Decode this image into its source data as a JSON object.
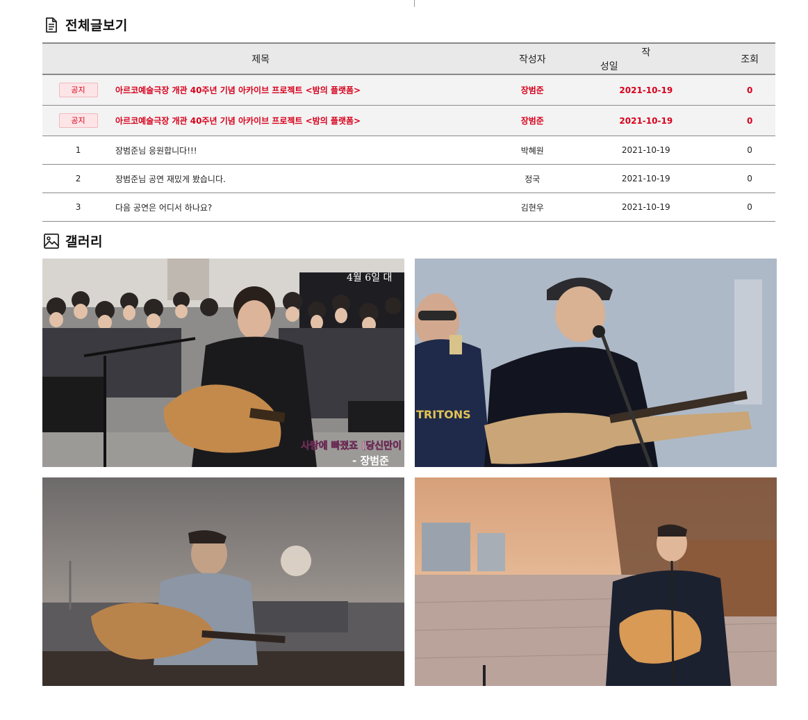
{
  "board": {
    "title": "전체글보기",
    "icon": "document-icon",
    "columns": {
      "subject": "제목",
      "author": "작성자",
      "date": "작성일",
      "views": "조회"
    },
    "notices": [
      {
        "badge": "공지",
        "subject": "아르코예술극장 개관 40주년 기념 아카이브 프로젝트 <밤의 플랫폼>",
        "author": "장범준",
        "date": "2021-10-19",
        "views": "0"
      },
      {
        "badge": "공지",
        "subject": "아르코예술극장 개관 40주년 기념 아카이브 프로젝트 <밤의 플랫폼>",
        "author": "장범준",
        "date": "2021-10-19",
        "views": "0"
      }
    ],
    "posts": [
      {
        "no": "1",
        "subject": "장범준님 응원합니다!!!",
        "author": "박혜원",
        "date": "2021-10-19",
        "views": "0"
      },
      {
        "no": "2",
        "subject": "장범준님 공연 재밌게 봤습니다.",
        "author": "정국",
        "date": "2021-10-19",
        "views": "0"
      },
      {
        "no": "3",
        "subject": "다음 공연은 어디서 하나요?",
        "author": "김현우",
        "date": "2021-10-19",
        "views": "0"
      }
    ],
    "notice_color": "#d8001c"
  },
  "gallery": {
    "title": "갤러리",
    "icon": "image-icon",
    "items": [
      {
        "overlay_top": "4월 6일 대",
        "overlay_song": "사랑에 빠졌죠 (당신만이",
        "overlay_artist": "- 장범준"
      },
      {
        "shirt_text": "TRITONS"
      },
      {},
      {}
    ]
  }
}
